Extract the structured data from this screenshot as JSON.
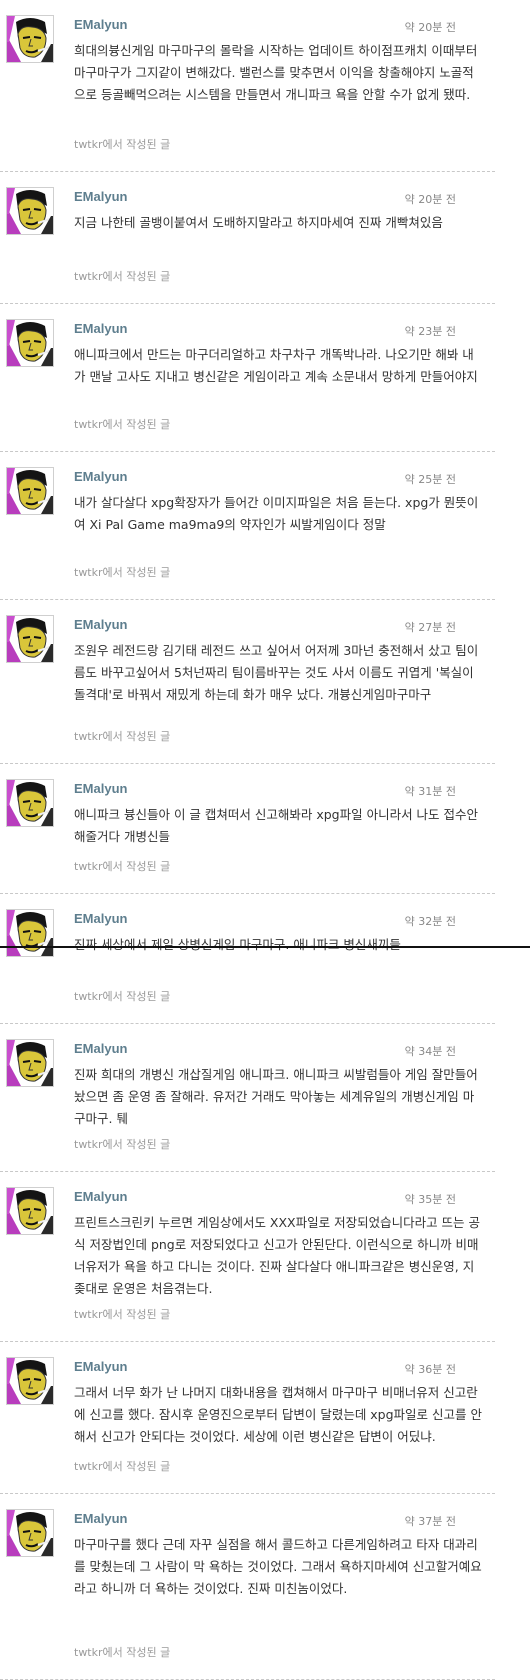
{
  "posts": [
    {
      "user": "EMalyun",
      "time": "약 20분 전",
      "text": "희대의븅신게임 마구마구의 몰락을 시작하는 업데이트 하이점프캐치 이때부터 마구마구가 그지같이 변해갔다. 밸런스를 맞추면서 이익을 창출해야지 노골적으로 등골빼먹으려는 시스템을 만들면서 개니파크 욕을 안할 수가 없게 됐따.",
      "source": "twtkr에서 작성된 글"
    },
    {
      "user": "EMalyun",
      "time": "약 20분 전",
      "text": "지금 나한테 골뱅이붙여서 도배하지말라고 하지마세여 진짜 개빡쳐있음",
      "source": "twtkr에서 작성된 글"
    },
    {
      "user": "EMalyun",
      "time": "약 23분 전",
      "text": "애니파크에서 만드는 마구더리얼하고 차구차구 개똑박나라. 나오기만 해봐 내가 맨날 고사도 지내고 병신같은 게임이라고 계속 소문내서 망하게 만들어야지",
      "source": "twtkr에서 작성된 글"
    },
    {
      "user": "EMalyun",
      "time": "약 25분 전",
      "text": "내가 살다살다 xpg확장자가 들어간 이미지파일은 처음 듣는다. xpg가 뭔뜻이여 Xi Pal Game ma9ma9의 약자인가 씨발게임이다 정말",
      "source": "twtkr에서 작성된 글"
    },
    {
      "user": "EMalyun",
      "time": "약 27분 전",
      "text": "조원우 레전드랑 김기태 레전드 쓰고 싶어서 어저께 3마넌 충전해서 샀고 팀이름도 바꾸고싶어서 5처넌짜리 팀이름바꾸는 것도 사서 이름도 귀엽게 '복실이돌격대'로 바꿔서 재밌게 하는데 화가 매우 났다. 개븅신게임마구마구",
      "source": "twtkr에서 작성된 글"
    },
    {
      "user": "EMalyun",
      "time": "약 31분 전",
      "text": "애니파크 븅신들아 이 글 캡쳐떠서 신고해봐라 xpg파일 아니라서 나도 접수안해줄거다 개병신들",
      "source": "twtkr에서 작성된 글"
    },
    {
      "user": "EMalyun",
      "time": "약 32분 전",
      "text": "진짜 세상에서 제일 상병신게임 마구마구. 애니파크 병신새끼들",
      "source": "twtkr에서 작성된 글"
    },
    {
      "user": "EMalyun",
      "time": "약 34분 전",
      "text": "진짜 희대의 개병신 개삽질게임 애니파크. 애니파크 씨발럼들아 게임 잘만들어놨으면 좀 운영 좀 잘해라. 유저간 거래도 막아놓는 세계유일의 개병신게임 마구마구. 퉤",
      "source": "twtkr에서 작성된 글"
    },
    {
      "user": "EMalyun",
      "time": "약 35분 전",
      "text": "프린트스크린키 누르면 게임상에서도 XXX파일로 저장되었습니다라고 뜨는 공식 저장법인데 png로 저장되었다고 신고가 안된단다. 이런식으로 하니까 비매너유저가 욕을 하고 다니는 것이다. 진짜 살다살다 애니파크같은 병신운영, 지좆대로 운영은 처음겪는다.",
      "source": "twtkr에서 작성된 글"
    },
    {
      "user": "EMalyun",
      "time": "약 36분 전",
      "text": "그래서 너무 화가 난 나머지 대화내용을 캡쳐해서 마구마구 비매너유저 신고란에 신고를 했다. 잠시후 운영진으로부터 답변이 달렸는데 xpg파일로 신고를 안해서 신고가 안되다는 것이었다. 세상에 이런 병신같은 답변이 어딨냐.",
      "source": "twtkr에서 작성된 글"
    },
    {
      "user": "EMalyun",
      "time": "약 37분 전",
      "text": "마구마구를 했다 근데 자꾸 실점을 해서 콜드하고 다른게임하려고 타자 대과리를 맞췄는데 그 사람이 막 욕하는 것이었다. 그래서 욕하지마세여 신고할거예요 라고 하니까 더 욕하는 것이었다. 진짜 미친놈이었다.",
      "source": "twtkr에서 작성된 글"
    }
  ]
}
